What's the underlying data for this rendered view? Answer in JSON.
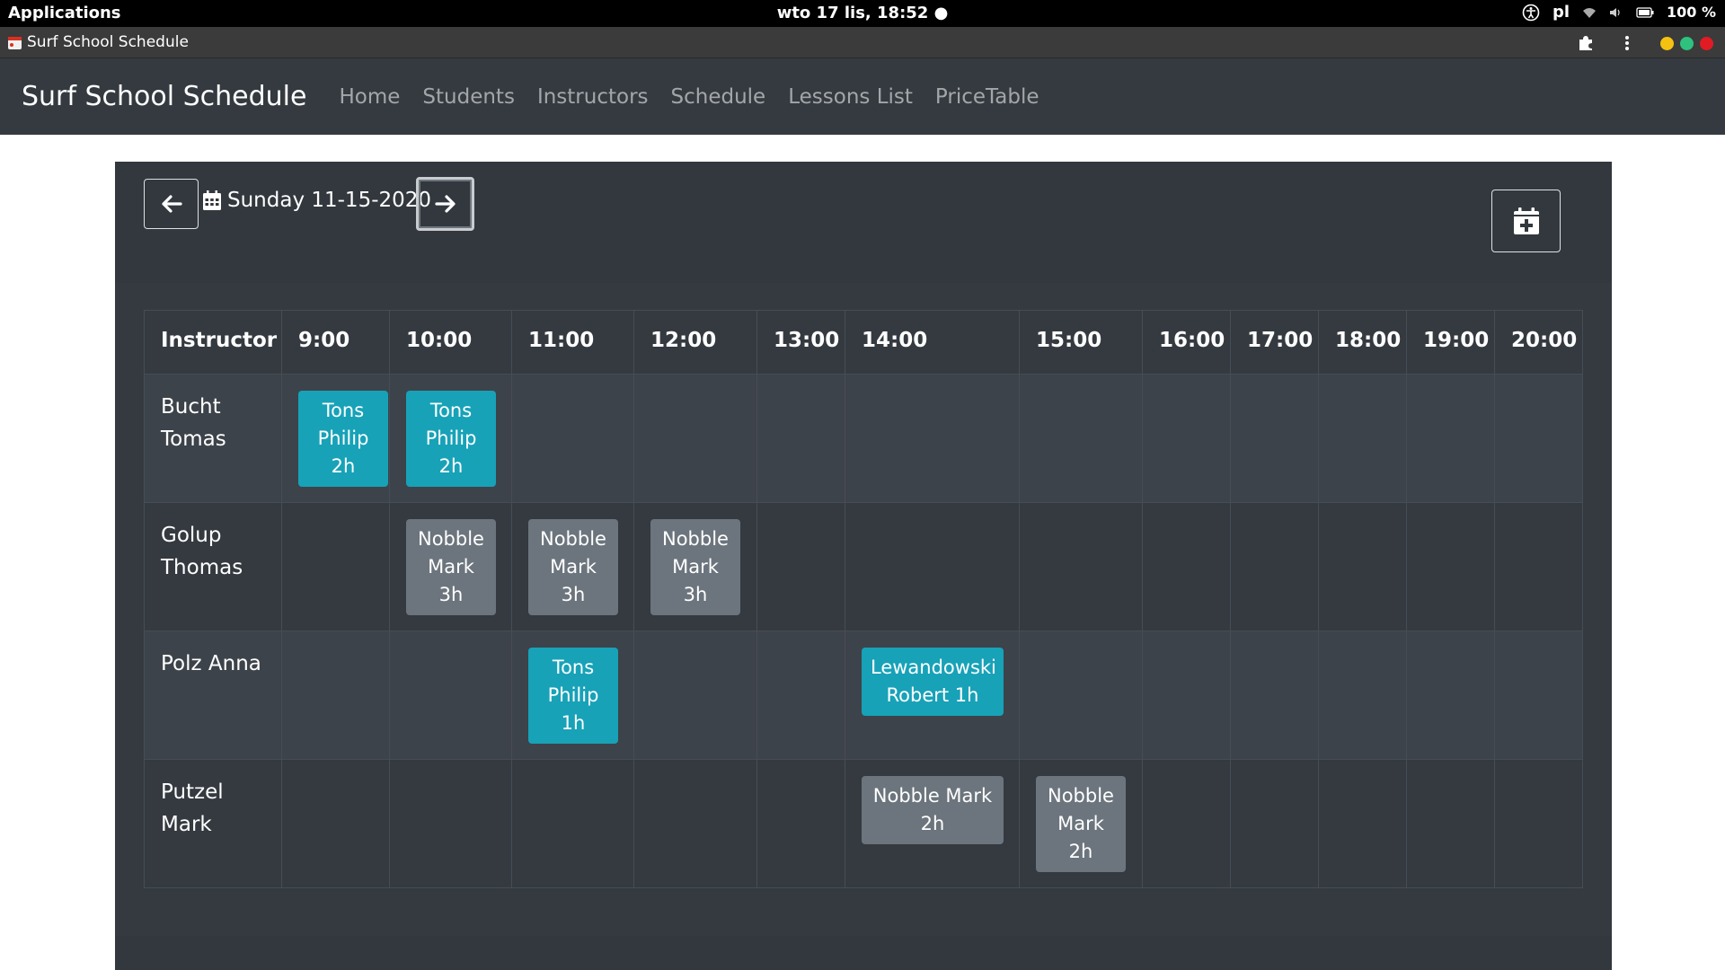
{
  "system_bar": {
    "applications": "Applications",
    "clock": "wto 17 lis, 18:52 ●",
    "language": "pl",
    "battery": "100 %"
  },
  "browser": {
    "tab_title": "Surf School Schedule",
    "window_controls": {
      "minimize_color": "#f5c211",
      "maximize_color": "#2ec27e",
      "close_color": "#e01b24"
    }
  },
  "navbar": {
    "brand": "Surf School Schedule",
    "links": [
      "Home",
      "Students",
      "Instructors",
      "Schedule",
      "Lessons List",
      "PriceTable"
    ]
  },
  "date_nav": {
    "prev_icon": "arrow-left-icon",
    "calendar_icon": "calendar-icon",
    "date": "Sunday 11-15-2020",
    "next_icon": "arrow-right-icon",
    "add_icon": "calendar-plus-icon"
  },
  "schedule": {
    "header": [
      "Instructor",
      "9:00",
      "10:00",
      "11:00",
      "12:00",
      "13:00",
      "14:00",
      "15:00",
      "16:00",
      "17:00",
      "18:00",
      "19:00",
      "20:00"
    ],
    "rows": [
      {
        "instructor": "Bucht Tomas",
        "lessons": [
          {
            "col": 1,
            "text": "Tons Philip 2h",
            "variant": "info"
          },
          {
            "col": 2,
            "text": "Tons Philip 2h",
            "variant": "info"
          }
        ]
      },
      {
        "instructor": "Golup Thomas",
        "lessons": [
          {
            "col": 2,
            "text": "Nobble Mark 3h",
            "variant": "secondary"
          },
          {
            "col": 3,
            "text": "Nobble Mark 3h",
            "variant": "secondary"
          },
          {
            "col": 4,
            "text": "Nobble Mark 3h",
            "variant": "secondary"
          }
        ]
      },
      {
        "instructor": "Polz Anna",
        "lessons": [
          {
            "col": 3,
            "text": "Tons Philip 1h",
            "variant": "info"
          },
          {
            "col": 6,
            "text": "Lewandowski Robert 1h",
            "variant": "info"
          }
        ]
      },
      {
        "instructor": "Putzel Mark",
        "lessons": [
          {
            "col": 6,
            "text": "Nobble Mark 2h",
            "variant": "secondary"
          },
          {
            "col": 7,
            "text": "Nobble Mark 2h",
            "variant": "secondary"
          }
        ]
      }
    ]
  },
  "colors": {
    "info": "#17a2b8",
    "secondary": "#6c757d",
    "dark": "#343a40"
  }
}
